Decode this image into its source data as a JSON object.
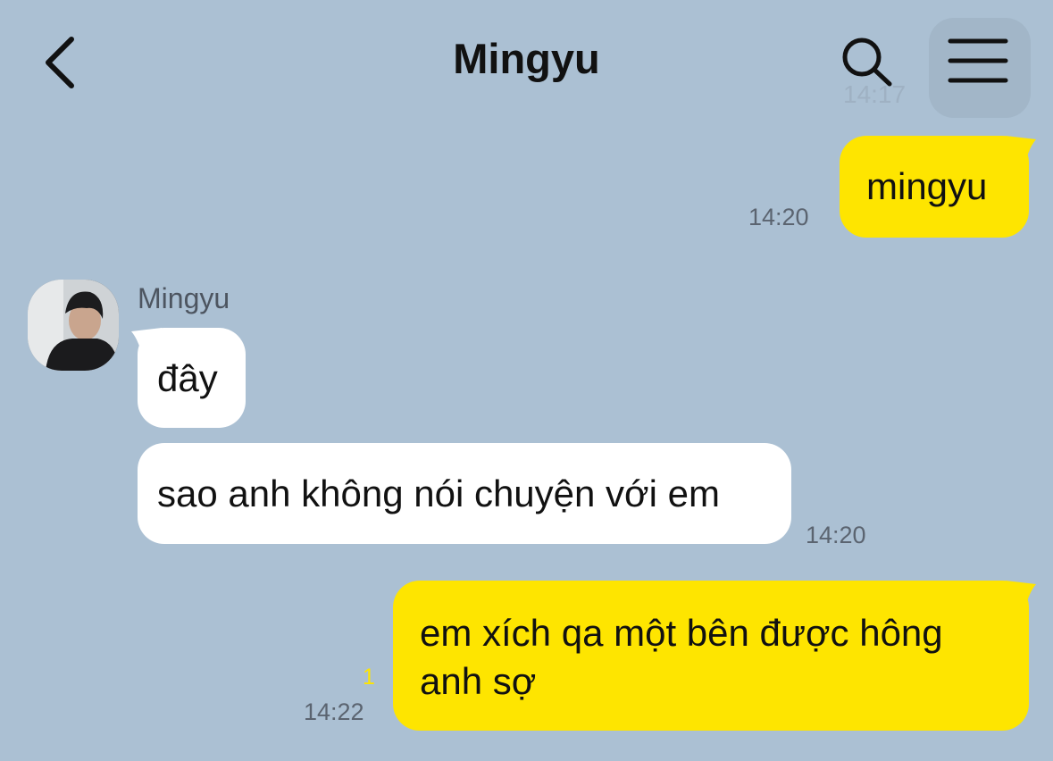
{
  "header": {
    "title": "Mingyu",
    "ghost_time": "14:17"
  },
  "messages": [
    {
      "from": "me",
      "text": "mingyu",
      "time": "14:20"
    },
    {
      "from": "them",
      "sender": "Mingyu",
      "text": "đây"
    },
    {
      "from": "them",
      "text": "sao anh không nói chuyện với em",
      "time": "14:20"
    },
    {
      "from": "me",
      "lines": [
        "em xích qa một bên được hông",
        "anh sợ"
      ],
      "unread": "1",
      "time": "14:22"
    }
  ],
  "colors": {
    "background": "#abc0d3",
    "my_bubble": "#fee500",
    "their_bubble": "#ffffff",
    "unread_count": "#fee500"
  },
  "icons": [
    "back-chevron-icon",
    "search-icon",
    "menu-icon"
  ]
}
